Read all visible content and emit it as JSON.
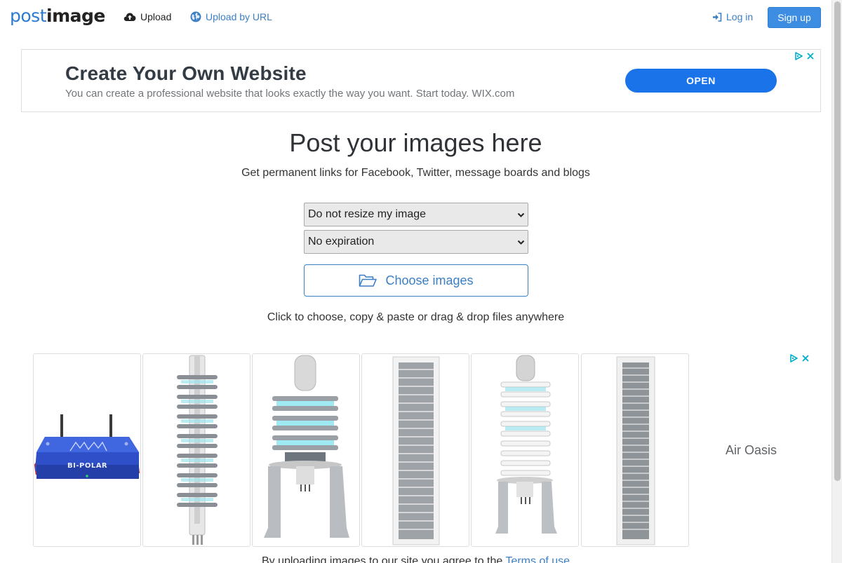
{
  "brand": {
    "logo_light": "post",
    "logo_bold": "image"
  },
  "nav": {
    "upload_label": "Upload",
    "upload_url_label": "Upload by URL",
    "login_label": "Log in",
    "signup_label": "Sign up"
  },
  "ad_top": {
    "title": "Create Your Own Website",
    "description": "You can create a professional website that looks exactly the way you want. Start today. WIX.com",
    "cta": "OPEN"
  },
  "main": {
    "headline": "Post your images here",
    "subheadline": "Get permanent links for Facebook, Twitter, message boards and blogs",
    "resize_select": {
      "selected": "Do not resize my image"
    },
    "expiration_select": {
      "selected": "No expiration"
    },
    "choose_button": "Choose images",
    "hint": "Click to choose, copy & paste or drag & drop files anywhere"
  },
  "ad_bottom": {
    "brand": "Air Oasis",
    "product_badge": "BI-POLAR"
  },
  "footer": {
    "terms_prefix": "By uploading images to our site you agree to the",
    "terms_link": "Terms of use"
  },
  "colors": {
    "link": "#3b7fc4",
    "signup_bg": "#3d8ee2",
    "ad_cta": "#1a73e8",
    "adchoices": "#00aecd"
  },
  "icons": {
    "upload": "cloud-upload-icon",
    "url": "globe-icon",
    "login": "sign-in-icon",
    "choose": "folder-open-icon",
    "adchoices": "adchoices-icon",
    "close": "close-icon"
  }
}
